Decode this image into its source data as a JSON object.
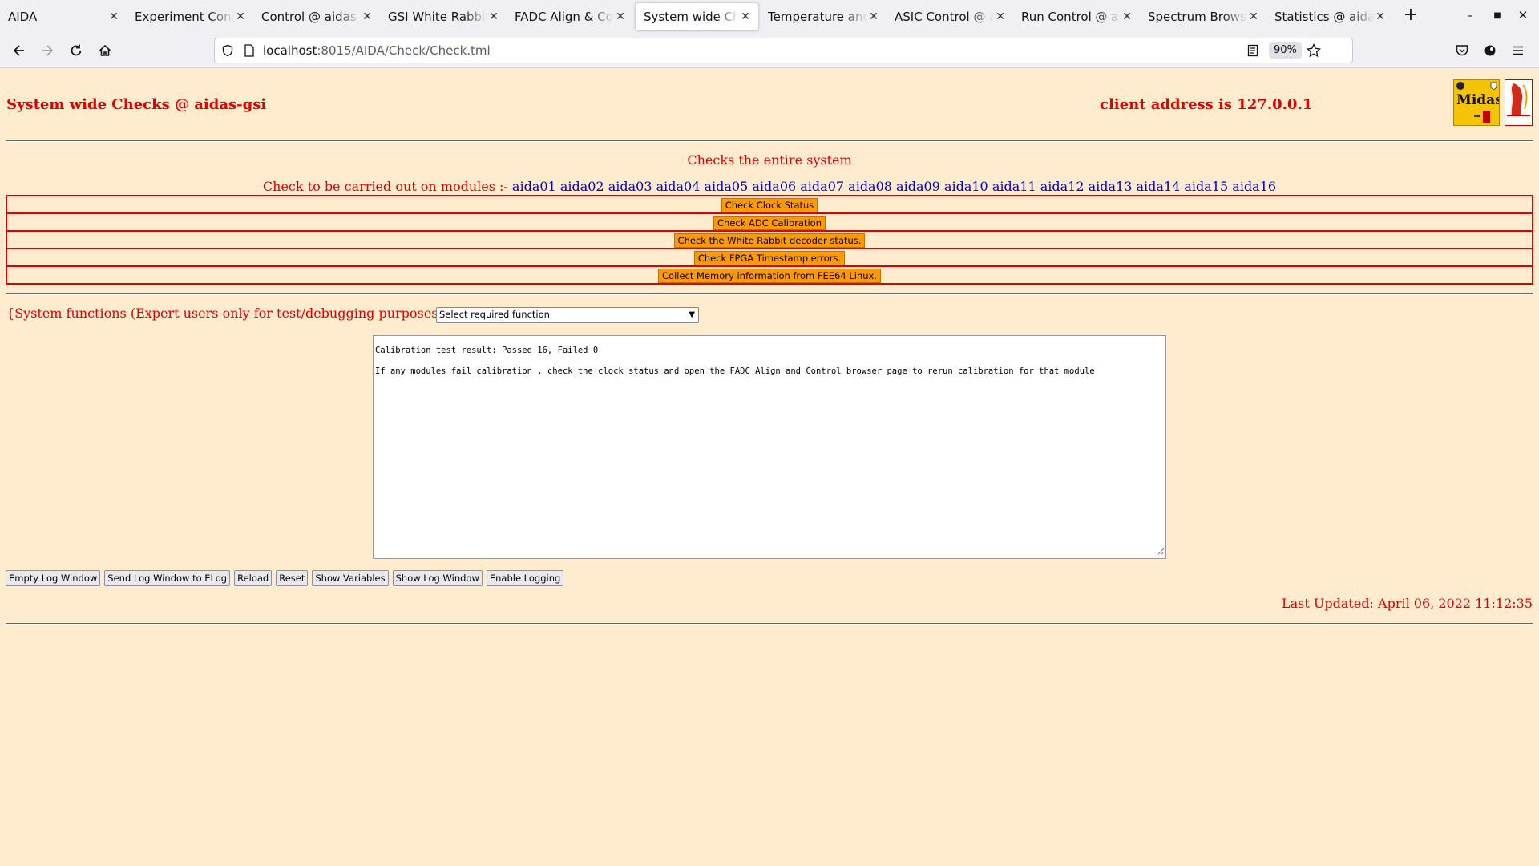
{
  "browser": {
    "tabs": [
      {
        "label": "AIDA",
        "active": false
      },
      {
        "label": "Experiment Control",
        "active": false
      },
      {
        "label": "Control @ aidas-gsi",
        "active": false
      },
      {
        "label": "GSI White Rabbit T",
        "active": false
      },
      {
        "label": "FADC Align & Cont",
        "active": false
      },
      {
        "label": "System wide Check",
        "active": true
      },
      {
        "label": "Temperature and st",
        "active": false
      },
      {
        "label": "ASIC Control @ aid",
        "active": false
      },
      {
        "label": "Run Control @ aida",
        "active": false
      },
      {
        "label": "Spectrum Browser",
        "active": false
      },
      {
        "label": "Statistics @ aidas-g",
        "active": false
      }
    ],
    "url_host": "localhost",
    "url_rest": ":8015/AIDA/Check/Check.tml",
    "zoom": "90%"
  },
  "page": {
    "title": "System wide Checks @ aidas-gsi",
    "client_address": "client address is 127.0.0.1",
    "checks_heading": "Checks the entire system",
    "modules_prefix": "Check to be carried out on modules :- ",
    "modules": [
      "aida01",
      "aida02",
      "aida03",
      "aida04",
      "aida05",
      "aida06",
      "aida07",
      "aida08",
      "aida09",
      "aida10",
      "aida11",
      "aida12",
      "aida13",
      "aida14",
      "aida15",
      "aida16"
    ],
    "check_buttons": [
      "Check Clock Status",
      "Check ADC Calibration",
      "Check the White Rabbit decoder status.",
      "Check FPGA Timestamp errors.",
      "Collect Memory information from FEE64 Linux."
    ],
    "system_functions_label": "{System functions (Expert users only for test/debugging purposes!!!)  } {",
    "function_select_value": "Select required function",
    "log_lines": [
      "Calibration test result: Passed 16, Failed 0",
      "If any modules fail calibration , check the clock status and open the FADC Align and Control browser page to rerun calibration for that module"
    ],
    "log_buttons": [
      "Empty Log Window",
      "Send Log Window to ELog",
      "Reload",
      "Reset",
      "Show Variables",
      "Show Log Window",
      "Enable Logging"
    ],
    "last_updated": "Last Updated: April 06, 2022 11:12:35"
  },
  "colors": {
    "page_background": "#ffebcd",
    "heading_red": "#e00000",
    "link_blue": "#0000c0",
    "check_button_orange": "#ff9900"
  }
}
